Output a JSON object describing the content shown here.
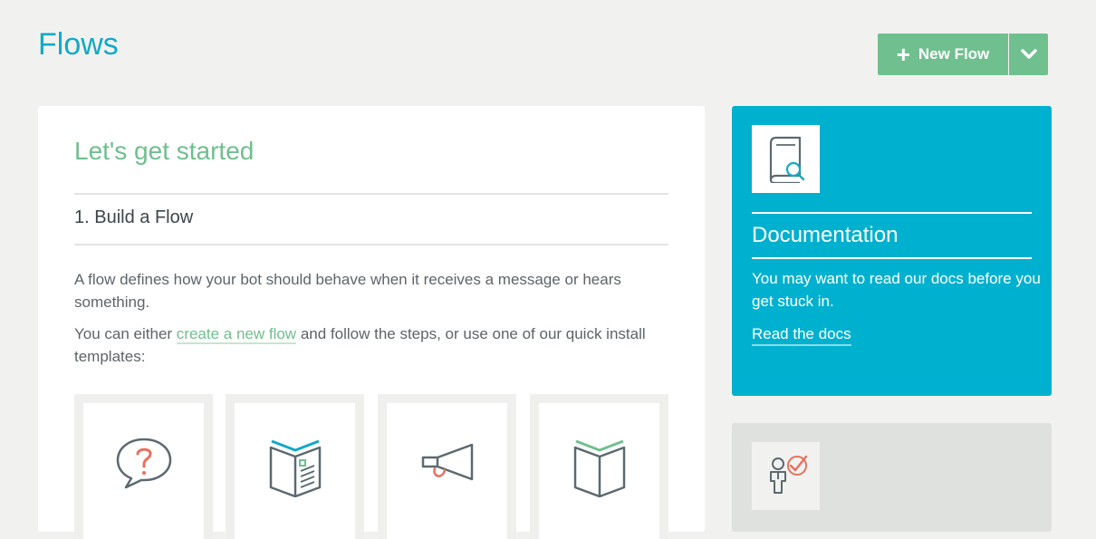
{
  "header": {
    "title": "Flows",
    "new_flow_label": "New Flow"
  },
  "main": {
    "heading": "Let's get started",
    "step_title": "1. Build a Flow",
    "paragraph1": "A flow defines how your bot should behave when it receives a message or hears something.",
    "paragraph2_before": "You can either ",
    "paragraph2_link": "create a new flow",
    "paragraph2_after": " and follow the steps, or use one of our quick install templates:",
    "templates": [
      {
        "icon": "question-speech-bubble-icon"
      },
      {
        "icon": "open-book-pages-icon"
      },
      {
        "icon": "megaphone-icon"
      },
      {
        "icon": "open-book-icon"
      }
    ]
  },
  "sidebar": {
    "doc_title": "Documentation",
    "doc_desc": "You may want to read our docs before you get stuck in.",
    "doc_link": "Read the docs",
    "doc_icon": "book-search-icon",
    "second_icon": "person-checkmark-icon"
  },
  "colors": {
    "brand_blue": "#13a9c7",
    "accent_green": "#70c08f",
    "doc_card": "#00b1cf",
    "icon_red": "#e8705e",
    "icon_grey": "#5c6a70"
  }
}
